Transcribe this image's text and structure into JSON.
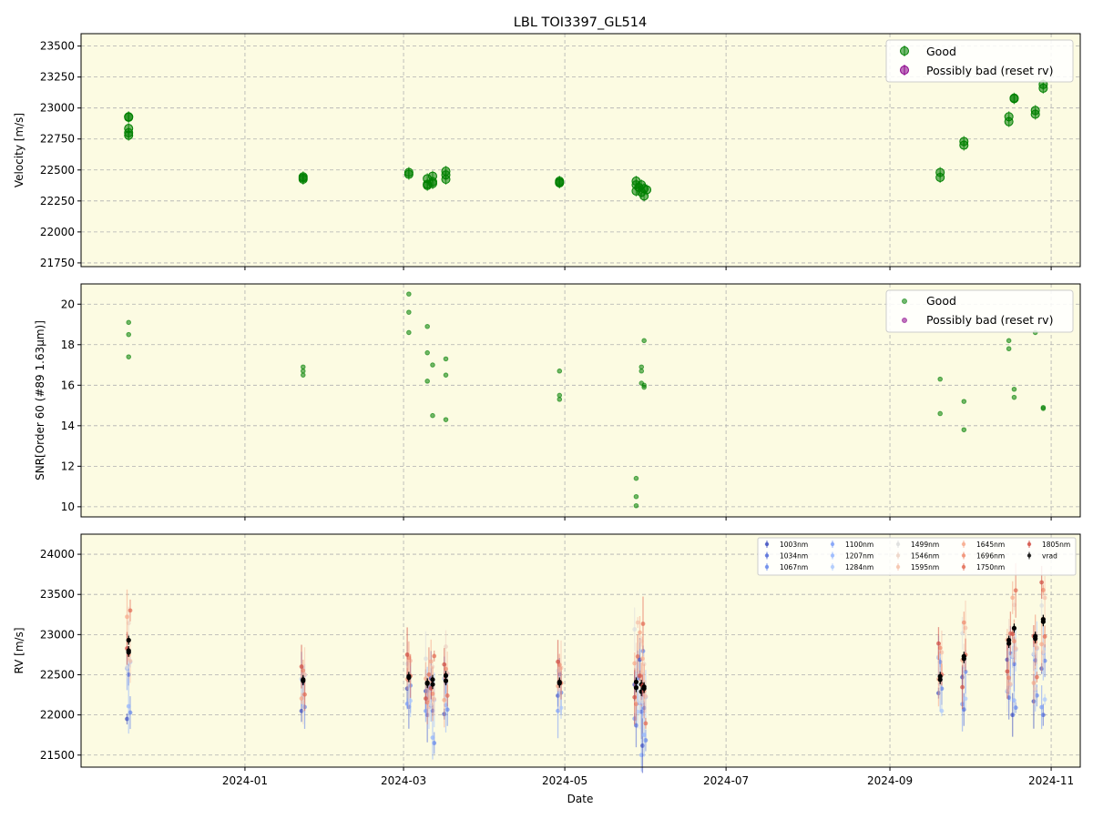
{
  "title": "LBL TOI3397_GL514",
  "xlabel": "Date",
  "colors": {
    "background": "#fcfbe2",
    "good": "#008000",
    "bad": "#8b008b",
    "grid": "#b0b0b0",
    "vrad": "#000000"
  },
  "chart_data": [
    {
      "type": "scatter",
      "panel": "velocity",
      "ylabel": "Velocity [m/s]",
      "xlim": [
        "2023-10-31",
        "2024-11-12"
      ],
      "ylim": [
        21720,
        23600
      ],
      "yticks": [
        21750,
        22000,
        22250,
        22500,
        22750,
        23000,
        23250,
        23500
      ],
      "xticks": [
        "2024-01",
        "2024-03",
        "2024-05",
        "2024-07",
        "2024-09",
        "2024-11"
      ],
      "grid": true,
      "legend": {
        "placement": "top-right",
        "entries": [
          "Good",
          "Possibly bad (reset rv)"
        ]
      },
      "series": [
        {
          "name": "Good",
          "points": [
            [
              "2023-11-18",
              22930
            ],
            [
              "2023-11-18",
              22925
            ],
            [
              "2023-11-18",
              22835
            ],
            [
              "2023-11-18",
              22780
            ],
            [
              "2023-11-18",
              22800
            ],
            [
              "2024-01-23",
              22445
            ],
            [
              "2024-01-23",
              22425
            ],
            [
              "2024-01-23",
              22435
            ],
            [
              "2024-03-03",
              22480
            ],
            [
              "2024-03-03",
              22465
            ],
            [
              "2024-03-10",
              22430
            ],
            [
              "2024-03-10",
              22385
            ],
            [
              "2024-03-10",
              22375
            ],
            [
              "2024-03-12",
              22450
            ],
            [
              "2024-03-12",
              22405
            ],
            [
              "2024-03-12",
              22390
            ],
            [
              "2024-03-17",
              22490
            ],
            [
              "2024-03-17",
              22460
            ],
            [
              "2024-03-17",
              22425
            ],
            [
              "2024-04-29",
              22410
            ],
            [
              "2024-04-29",
              22400
            ],
            [
              "2024-04-29",
              22395
            ],
            [
              "2024-05-28",
              22410
            ],
            [
              "2024-05-28",
              22380
            ],
            [
              "2024-05-28",
              22330
            ],
            [
              "2024-05-29",
              22360
            ],
            [
              "2024-05-30",
              22380
            ],
            [
              "2024-05-30",
              22320
            ],
            [
              "2024-05-31",
              22290
            ],
            [
              "2024-05-31",
              22350
            ],
            [
              "2024-06-01",
              22340
            ],
            [
              "2024-09-20",
              22480
            ],
            [
              "2024-09-20",
              22440
            ],
            [
              "2024-09-29",
              22730
            ],
            [
              "2024-09-29",
              22700
            ],
            [
              "2024-10-16",
              22930
            ],
            [
              "2024-10-16",
              22890
            ],
            [
              "2024-10-18",
              23080
            ],
            [
              "2024-10-18",
              23075
            ],
            [
              "2024-10-26",
              22980
            ],
            [
              "2024-10-26",
              22950
            ],
            [
              "2024-10-29",
              23190
            ],
            [
              "2024-10-29",
              23160
            ]
          ]
        },
        {
          "name": "Possibly bad (reset rv)",
          "points": []
        }
      ]
    },
    {
      "type": "scatter",
      "panel": "snr",
      "ylabel": "SNR[Order 60 (#89 1.63μm)]",
      "xlim": [
        "2023-10-31",
        "2024-11-12"
      ],
      "ylim": [
        9.5,
        21.0
      ],
      "yticks": [
        10,
        12,
        14,
        16,
        18,
        20
      ],
      "grid": true,
      "legend": {
        "placement": "top-right",
        "entries": [
          "Good",
          "Possibly bad (reset rv)"
        ]
      },
      "series": [
        {
          "name": "Good",
          "points": [
            [
              "2023-11-18",
              19.1
            ],
            [
              "2023-11-18",
              18.5
            ],
            [
              "2023-11-18",
              17.4
            ],
            [
              "2024-01-23",
              16.9
            ],
            [
              "2024-01-23",
              16.7
            ],
            [
              "2024-01-23",
              16.5
            ],
            [
              "2024-03-03",
              20.5
            ],
            [
              "2024-03-03",
              19.6
            ],
            [
              "2024-03-03",
              18.6
            ],
            [
              "2024-03-10",
              18.9
            ],
            [
              "2024-03-10",
              17.6
            ],
            [
              "2024-03-10",
              16.2
            ],
            [
              "2024-03-12",
              17.0
            ],
            [
              "2024-03-12",
              14.5
            ],
            [
              "2024-03-17",
              17.3
            ],
            [
              "2024-03-17",
              16.5
            ],
            [
              "2024-03-17",
              14.3
            ],
            [
              "2024-04-29",
              16.7
            ],
            [
              "2024-04-29",
              15.5
            ],
            [
              "2024-04-29",
              15.3
            ],
            [
              "2024-05-28",
              11.4
            ],
            [
              "2024-05-28",
              10.5
            ],
            [
              "2024-05-28",
              10.05
            ],
            [
              "2024-05-30",
              16.9
            ],
            [
              "2024-05-30",
              16.7
            ],
            [
              "2024-05-30",
              16.1
            ],
            [
              "2024-05-31",
              18.2
            ],
            [
              "2024-05-31",
              16.0
            ],
            [
              "2024-05-31",
              15.9
            ],
            [
              "2024-09-20",
              16.3
            ],
            [
              "2024-09-20",
              14.6
            ],
            [
              "2024-09-29",
              15.2
            ],
            [
              "2024-09-29",
              13.8
            ],
            [
              "2024-10-16",
              18.2
            ],
            [
              "2024-10-16",
              17.8
            ],
            [
              "2024-10-18",
              15.8
            ],
            [
              "2024-10-18",
              15.4
            ],
            [
              "2024-10-26",
              18.6
            ],
            [
              "2024-10-29",
              14.9
            ],
            [
              "2024-10-29",
              14.85
            ]
          ]
        },
        {
          "name": "Possibly bad (reset rv)",
          "points": []
        }
      ]
    },
    {
      "type": "scatter",
      "panel": "rv",
      "ylabel": "RV [m/s]",
      "xlim": [
        "2023-10-31",
        "2024-11-12"
      ],
      "ylim": [
        21350,
        24250
      ],
      "yticks": [
        21500,
        22000,
        22500,
        23000,
        23500,
        24000
      ],
      "xticks": [
        "2024-01",
        "2024-03",
        "2024-05",
        "2024-07",
        "2024-09",
        "2024-11"
      ],
      "grid": true,
      "legend": {
        "placement": "top-right",
        "columns": 5,
        "entries": [
          "1003nm",
          "1034nm",
          "1067nm",
          "1100nm",
          "1207nm",
          "1284nm",
          "1499nm",
          "1546nm",
          "1595nm",
          "1645nm",
          "1696nm",
          "1750nm",
          "1805nm",
          "vrad"
        ]
      },
      "band_colors": [
        "#3b4cc0",
        "#4e68d8",
        "#6384eb",
        "#7a9df8",
        "#92b4fe",
        "#aac7fd",
        "#dcdddd",
        "#ecd3c5",
        "#f5c1a9",
        "#f7a889",
        "#f08b6e",
        "#e36a53",
        "#d24b40",
        "#000000"
      ],
      "epochs": [
        {
          "date": "2023-11-18",
          "vrad": [
            22930,
            22800,
            22780
          ],
          "spread": [
            21950,
            23300
          ]
        },
        {
          "date": "2024-01-23",
          "vrad": [
            22440,
            22425
          ],
          "spread": [
            21900,
            22750
          ]
        },
        {
          "date": "2024-03-03",
          "vrad": [
            22480,
            22465
          ],
          "spread": [
            22100,
            22750
          ]
        },
        {
          "date": "2024-03-10",
          "vrad": [
            22400,
            22390
          ],
          "spread": [
            21850,
            22700
          ]
        },
        {
          "date": "2024-03-12",
          "vrad": [
            22440,
            22380
          ],
          "spread": [
            21650,
            22800
          ]
        },
        {
          "date": "2024-03-17",
          "vrad": [
            22490,
            22425
          ],
          "spread": [
            21900,
            22850
          ]
        },
        {
          "date": "2024-04-29",
          "vrad": [
            22410,
            22395
          ],
          "spread": [
            22050,
            22700
          ]
        },
        {
          "date": "2024-05-28",
          "vrad": [
            22410,
            22340
          ],
          "spread": [
            21700,
            23150
          ]
        },
        {
          "date": "2024-05-30",
          "vrad": [
            22380,
            22290
          ],
          "spread": [
            21500,
            23350
          ]
        },
        {
          "date": "2024-05-31",
          "vrad": [
            22350,
            22330
          ],
          "spread": [
            21550,
            22700
          ]
        },
        {
          "date": "2024-09-20",
          "vrad": [
            22480,
            22440
          ],
          "spread": [
            22050,
            23000
          ]
        },
        {
          "date": "2024-09-29",
          "vrad": [
            22730,
            22700
          ],
          "spread": [
            22000,
            23150
          ]
        },
        {
          "date": "2024-10-16",
          "vrad": [
            22930,
            22890
          ],
          "spread": [
            21900,
            23250
          ]
        },
        {
          "date": "2024-10-18",
          "vrad": [
            23080
          ],
          "spread": [
            22000,
            23550
          ]
        },
        {
          "date": "2024-10-26",
          "vrad": [
            22980,
            22950
          ],
          "spread": [
            21950,
            23200
          ]
        },
        {
          "date": "2024-10-29",
          "vrad": [
            23190,
            23160
          ],
          "spread": [
            22000,
            23650
          ]
        }
      ]
    }
  ]
}
